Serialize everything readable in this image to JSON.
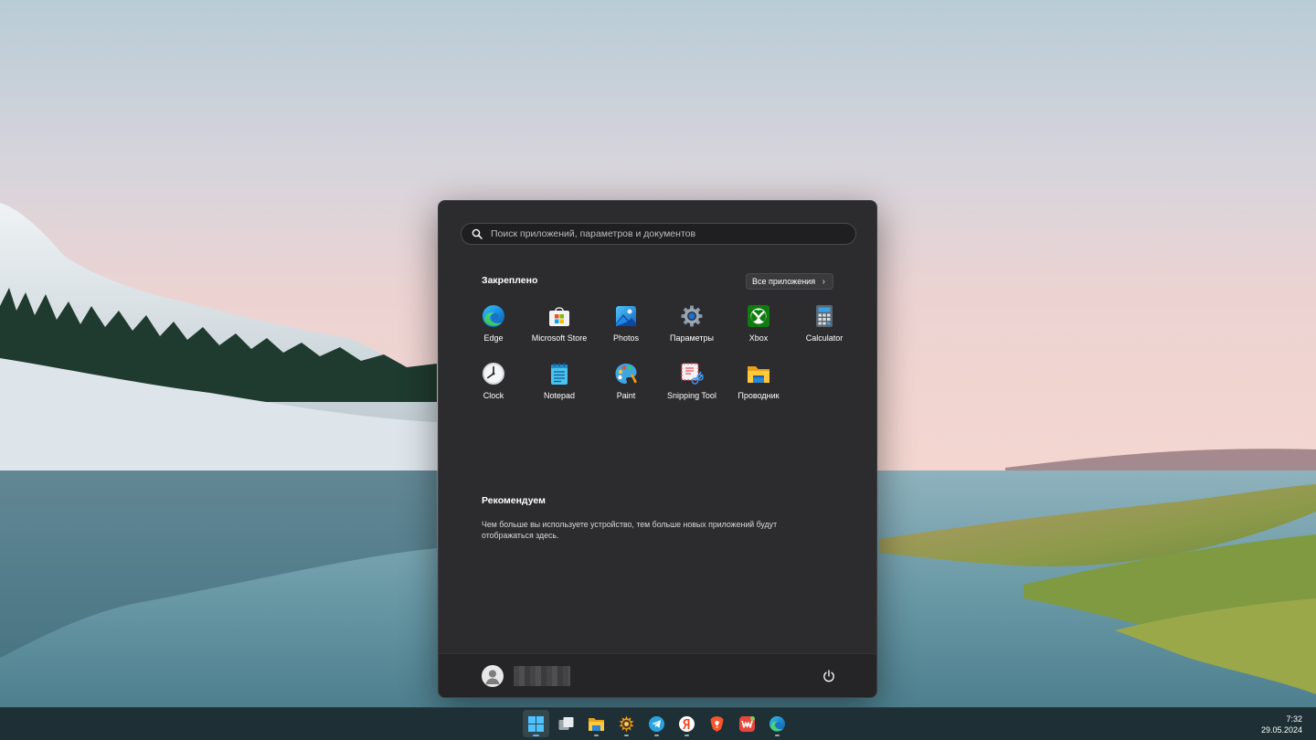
{
  "start_menu": {
    "search_placeholder": "Поиск приложений, параметров и документов",
    "pinned_title": "Закреплено",
    "all_apps_label": "Все приложения",
    "pinned_apps": [
      {
        "label": "Edge",
        "icon": "edge-icon"
      },
      {
        "label": "Microsoft Store",
        "icon": "store-icon"
      },
      {
        "label": "Photos",
        "icon": "photos-icon"
      },
      {
        "label": "Параметры",
        "icon": "settings-gear-icon"
      },
      {
        "label": "Xbox",
        "icon": "xbox-icon"
      },
      {
        "label": "Calculator",
        "icon": "calculator-icon"
      },
      {
        "label": "Clock",
        "icon": "clock-icon"
      },
      {
        "label": "Notepad",
        "icon": "notepad-icon"
      },
      {
        "label": "Paint",
        "icon": "paint-palette-icon"
      },
      {
        "label": "Snipping Tool",
        "icon": "snipping-tool-icon"
      },
      {
        "label": "Проводник",
        "icon": "folder-icon"
      }
    ],
    "recommend_title": "Рекомендуем",
    "recommend_text": "Чем больше вы используете устройство, тем больше новых приложений будут отображаться здесь."
  },
  "taskbar": {
    "items": [
      {
        "icon": "windows-start-icon",
        "active": true
      },
      {
        "icon": "task-view-icon",
        "active": false
      },
      {
        "icon": "file-explorer-icon",
        "active": false
      },
      {
        "icon": "xnview-icon",
        "active": false
      },
      {
        "icon": "telegram-icon",
        "active": false
      },
      {
        "icon": "yandex-browser-icon",
        "active": false
      },
      {
        "icon": "brave-icon",
        "active": false
      },
      {
        "icon": "wps-office-icon",
        "active": false
      },
      {
        "icon": "edge-icon",
        "active": false
      }
    ],
    "time": "7:32",
    "date": "29.05.2024"
  }
}
